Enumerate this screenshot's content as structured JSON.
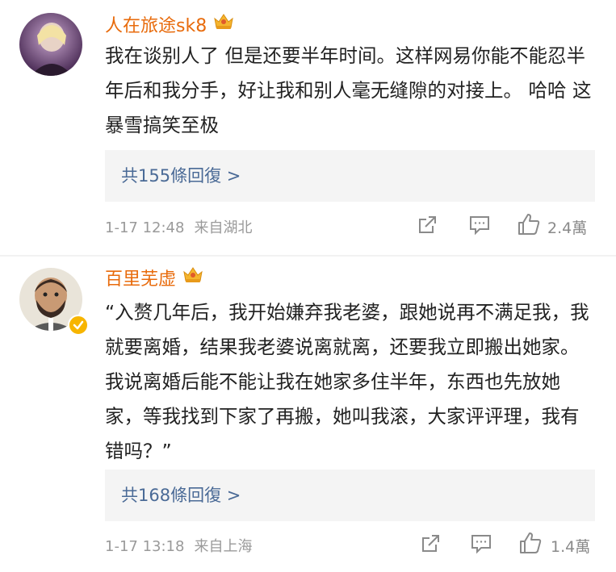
{
  "comments": [
    {
      "username": "人在旅途sk8",
      "text": "我在谈别人了 但是还要半年时间。这样网易你能不能忍半年后和我分手，好让我和别人毫无缝隙的对接上。 哈哈 这暴雪搞笑至极",
      "reply_link": "共155條回復 >",
      "timestamp": "1-17 12:48",
      "source": "来自湖北",
      "likes": "2.4萬"
    },
    {
      "username": "百里芜虚",
      "text": "“入赘几年后，我开始嫌弃我老婆，跟她说再不满足我，我就要离婚，结果我老婆说离就离，还要我立即搬出她家。我说离婚后能不能让我在她家多住半年，东西也先放她家，等我找到下家了再搬，她叫我滚，大家评评理，我有错吗？”",
      "reply_link": "共168條回復 >",
      "timestamp": "1-17 13:18",
      "source": "来自上海",
      "likes": "1.4萬"
    }
  ],
  "colors": {
    "username": "#e86b0c",
    "reply_link": "#4a6a96",
    "meta": "#9a9a9a",
    "reply_bg": "#f4f4f4"
  },
  "icons": {
    "crown": "crown-icon",
    "share": "share-icon",
    "comment": "comment-icon",
    "like": "thumbs-up-icon",
    "verified": "verified-badge-icon"
  }
}
